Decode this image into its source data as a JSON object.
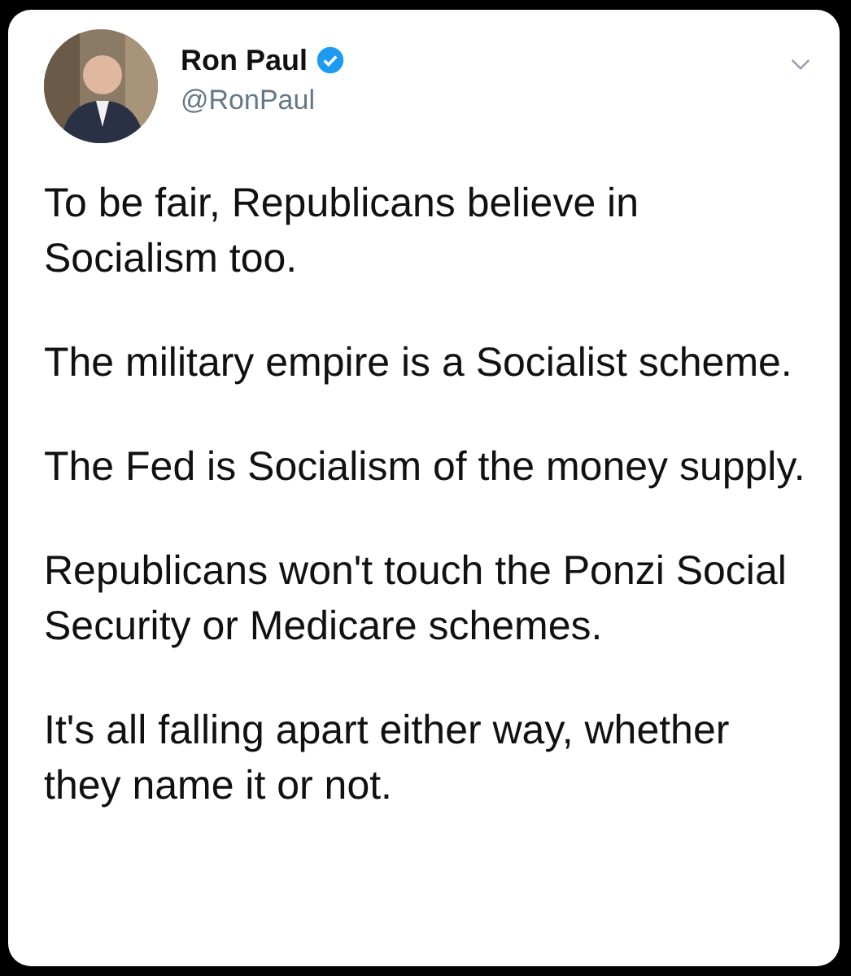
{
  "tweet": {
    "author": {
      "name": "Ron Paul",
      "handle": "@RonPaul",
      "verified": true
    },
    "paragraphs": [
      "To be fair, Republicans believe in Socialism too.",
      "The military empire is a Socialist scheme.",
      "The Fed is Socialism of the money supply.",
      "Republicans won't touch the Ponzi Social Security or Medicare schemes.",
      "It's all falling apart either way, whether they name it or not."
    ]
  }
}
